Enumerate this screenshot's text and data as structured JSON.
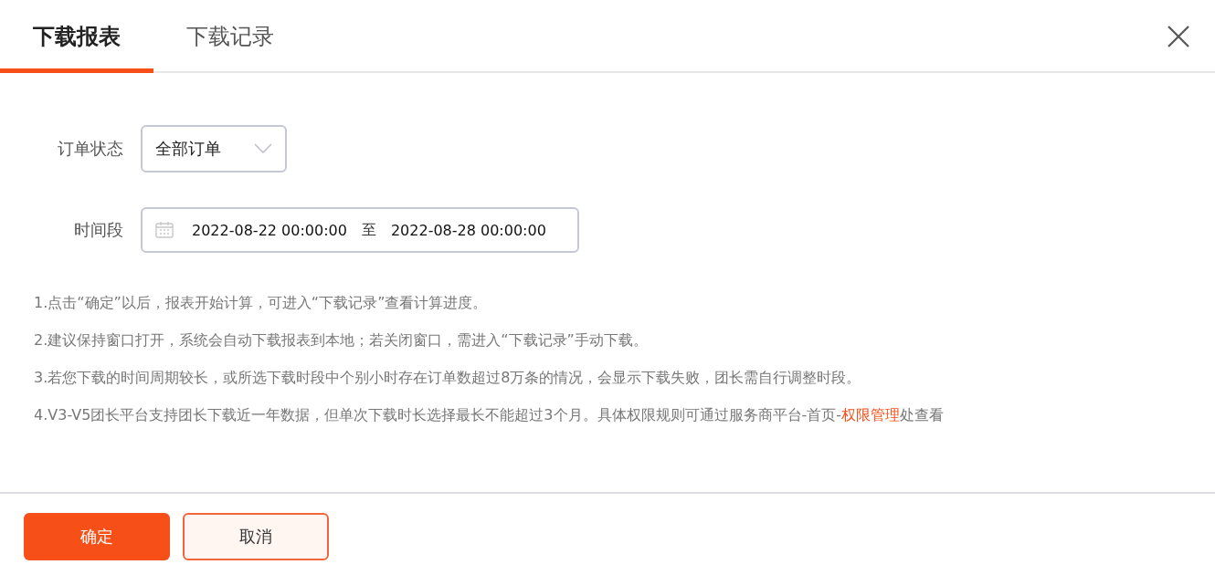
{
  "tabs": [
    {
      "label": "下载报表",
      "selected": true
    },
    {
      "label": "下载记录",
      "selected": false
    }
  ],
  "form": {
    "status": {
      "label": "订单状态",
      "value": "全部订单"
    },
    "period": {
      "label": "时间段",
      "start": "2022-08-22 00:00:00",
      "separator": "至",
      "end": "2022-08-28 00:00:00"
    }
  },
  "notes": [
    {
      "text": "1.点击“确定”以后，报表开始计算，可进入“下载记录”查看计算进度。"
    },
    {
      "text": "2.建议保持窗口打开，系统会自动下载报表到本地；若关闭窗口，需进入“下载记录”手动下载。"
    },
    {
      "text": "3.若您下载的时间周期较长，或所选下载时段中个别小时存在订单数超过8万条的情况，会显示下载失败，团长需自行调整时段。"
    },
    {
      "text": "4.V3-V5团长平台支持团长下载近一年数据，但单次下载时长选择最长不能超过3个月。具体权限规则可通过服务商平台-首页-",
      "link": "权限管理",
      "after": "处查看"
    }
  ],
  "buttons": [
    {
      "label": "确定",
      "kind": "primary"
    },
    {
      "label": "取消",
      "kind": "secondary"
    }
  ]
}
